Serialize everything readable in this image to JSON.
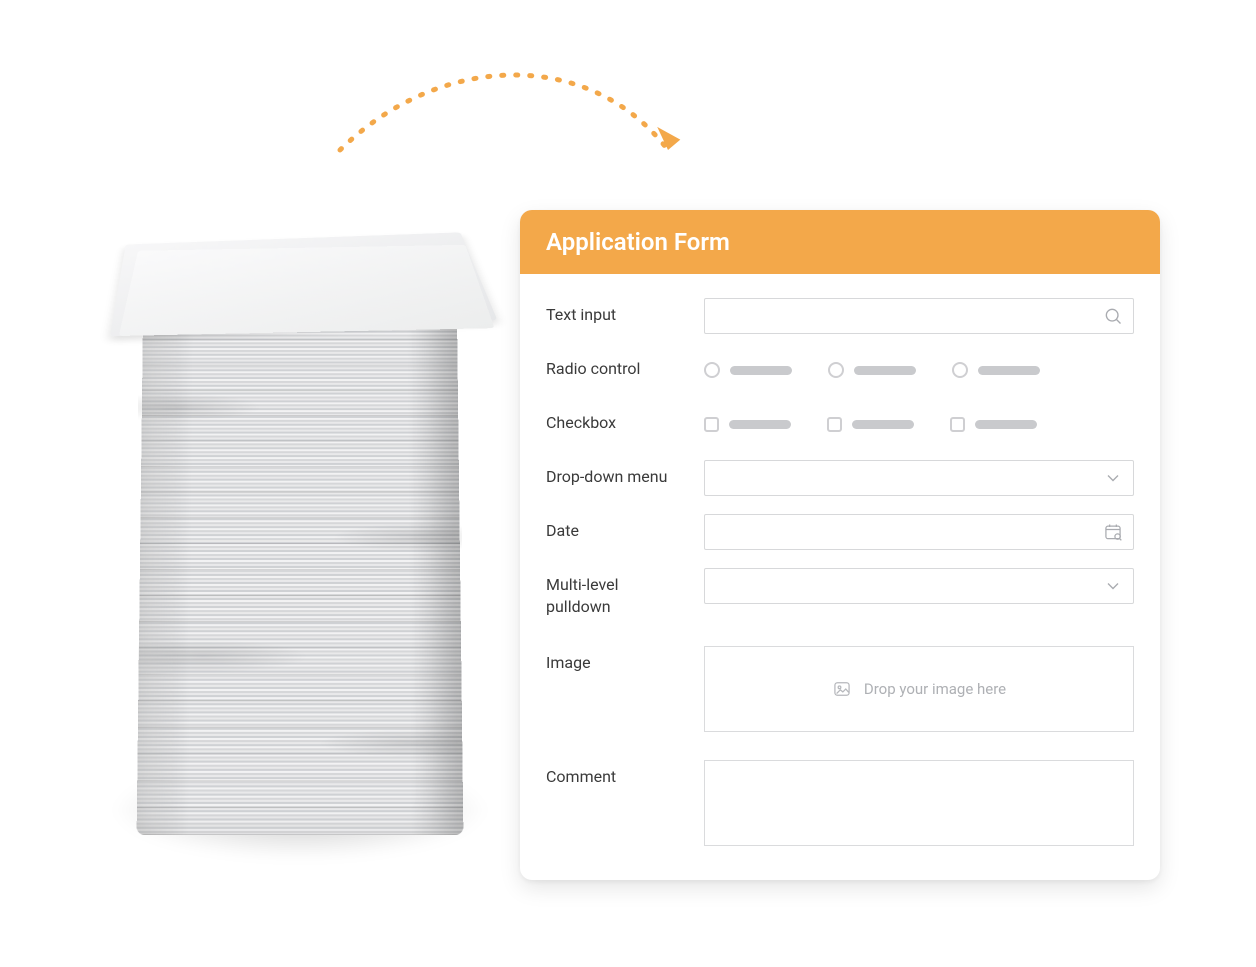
{
  "colors": {
    "accent": "#f3a84a",
    "arrow": "#f3a84a",
    "text": "#3a3a3a",
    "muted": "#aeb0b4",
    "border": "#d7d8da"
  },
  "form": {
    "title": "Application Form",
    "fields": {
      "text_input": {
        "label": "Text input",
        "icon": "magnifier-icon"
      },
      "radio": {
        "label": "Radio control",
        "option_count": 3
      },
      "checkbox": {
        "label": "Checkbox",
        "option_count": 3
      },
      "dropdown": {
        "label": "Drop-down menu",
        "icon": "chevron-down-icon"
      },
      "date": {
        "label": "Date",
        "icon": "calendar-icon"
      },
      "multilevel": {
        "label": "Multi-level pulldown",
        "icon": "chevron-down-icon"
      },
      "image": {
        "label": "Image",
        "drop_hint": "Drop your image here",
        "icon": "image-icon"
      },
      "comment": {
        "label": "Comment"
      }
    }
  }
}
